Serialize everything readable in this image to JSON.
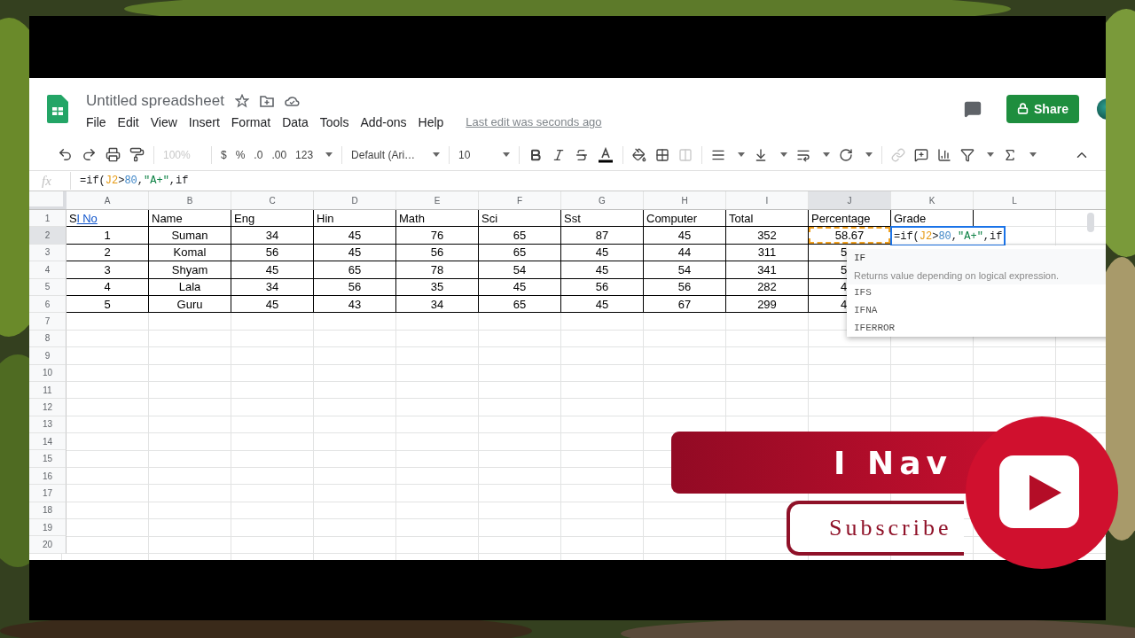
{
  "app": {
    "title": "Untitled spreadsheet",
    "menu": [
      "File",
      "Edit",
      "View",
      "Insert",
      "Format",
      "Data",
      "Tools",
      "Add-ons",
      "Help"
    ],
    "last_edit": "Last edit was seconds ago",
    "share_label": "Share"
  },
  "toolbar": {
    "zoom": "100%",
    "currency": "$",
    "percent": "%",
    "decrease_decimals": ".0",
    "increase_decimals": ".00",
    "number_format": "123",
    "font": "Default (Ari…",
    "font_size": "10"
  },
  "formula_bar": {
    "label": "fx",
    "segments": [
      {
        "text": "=if("
      },
      {
        "text": "J2",
        "color": "#e69a13"
      },
      {
        "text": ">"
      },
      {
        "text": "80",
        "color": "#3d85c6"
      },
      {
        "text": ","
      },
      {
        "text": "\"A+\"",
        "color": "#0b8043"
      },
      {
        "text": ",if"
      }
    ]
  },
  "sheet": {
    "columns": [
      {
        "label": "A",
        "selected": false
      },
      {
        "label": "B",
        "selected": false
      },
      {
        "label": "C",
        "selected": false
      },
      {
        "label": "D",
        "selected": false
      },
      {
        "label": "E",
        "selected": false
      },
      {
        "label": "F",
        "selected": false
      },
      {
        "label": "G",
        "selected": false
      },
      {
        "label": "H",
        "selected": false
      },
      {
        "label": "I",
        "selected": false
      },
      {
        "label": "J",
        "selected": true
      },
      {
        "label": "K",
        "selected": false
      },
      {
        "label": "L",
        "selected": false
      }
    ],
    "rows": [
      {
        "label": "1",
        "selected": false,
        "cells": [
          {
            "kind": "linked",
            "parts": [
              {
                "text": "S",
                "linked": false
              },
              {
                "text": "l No",
                "linked": true
              }
            ]
          },
          "Name",
          "Eng",
          "Hin",
          "Math",
          "Sci",
          "Sst",
          "Computer",
          "Total",
          "Percentage",
          "Grade"
        ]
      },
      {
        "label": "2",
        "selected": true,
        "cells": [
          "1",
          "Suman",
          "34",
          "45",
          "76",
          "65",
          "87",
          "45",
          "352",
          {
            "kind": "reference",
            "text": "58.67"
          },
          {
            "kind": "editor",
            "segments": [
              {
                "text": "=if("
              },
              {
                "text": "J2",
                "color": "#e69a13"
              },
              {
                "text": ">"
              },
              {
                "text": "80",
                "color": "#3d85c6"
              },
              {
                "text": ","
              },
              {
                "text": "\"A+\"",
                "color": "#0b8043"
              },
              {
                "text": ",if"
              }
            ]
          }
        ]
      },
      {
        "label": "3",
        "selected": false,
        "cells": [
          "2",
          "Komal",
          "56",
          "45",
          "56",
          "65",
          "45",
          "44",
          "311",
          {
            "kind": "clipped",
            "text": "5"
          }
        ]
      },
      {
        "label": "4",
        "selected": false,
        "cells": [
          "3",
          "Shyam",
          "45",
          "65",
          "78",
          "54",
          "45",
          "54",
          "341",
          {
            "kind": "clipped",
            "text": "5"
          }
        ]
      },
      {
        "label": "5",
        "selected": false,
        "cells": [
          "4",
          "Lala",
          "34",
          "56",
          "35",
          "45",
          "56",
          "56",
          "282",
          {
            "kind": "clipped",
            "text": "4"
          }
        ]
      },
      {
        "label": "6",
        "selected": false,
        "cells": [
          "5",
          "Guru",
          "45",
          "43",
          "34",
          "65",
          "45",
          "67",
          "299",
          {
            "kind": "clipped",
            "text": "4"
          }
        ]
      },
      {
        "label": "7",
        "selected": false
      },
      {
        "label": "8",
        "selected": false
      },
      {
        "label": "9",
        "selected": false
      },
      {
        "label": "10",
        "selected": false
      },
      {
        "label": "11",
        "selected": false
      },
      {
        "label": "12",
        "selected": false
      },
      {
        "label": "13",
        "selected": false
      },
      {
        "label": "14",
        "selected": false
      },
      {
        "label": "15",
        "selected": false
      },
      {
        "label": "16",
        "selected": false
      },
      {
        "label": "17",
        "selected": false
      },
      {
        "label": "18",
        "selected": false
      },
      {
        "label": "19",
        "selected": false
      },
      {
        "label": "20",
        "selected": false
      }
    ]
  },
  "autocomplete": {
    "items": [
      {
        "name": "IF",
        "selected": true,
        "description": "Returns value depending on logical expression."
      },
      {
        "name": "IFS",
        "selected": false
      },
      {
        "name": "IFNA",
        "selected": false
      },
      {
        "name": "IFERROR",
        "selected": false
      }
    ]
  },
  "branding": {
    "channel": "I Nav",
    "subscribe": "Subscribe"
  }
}
